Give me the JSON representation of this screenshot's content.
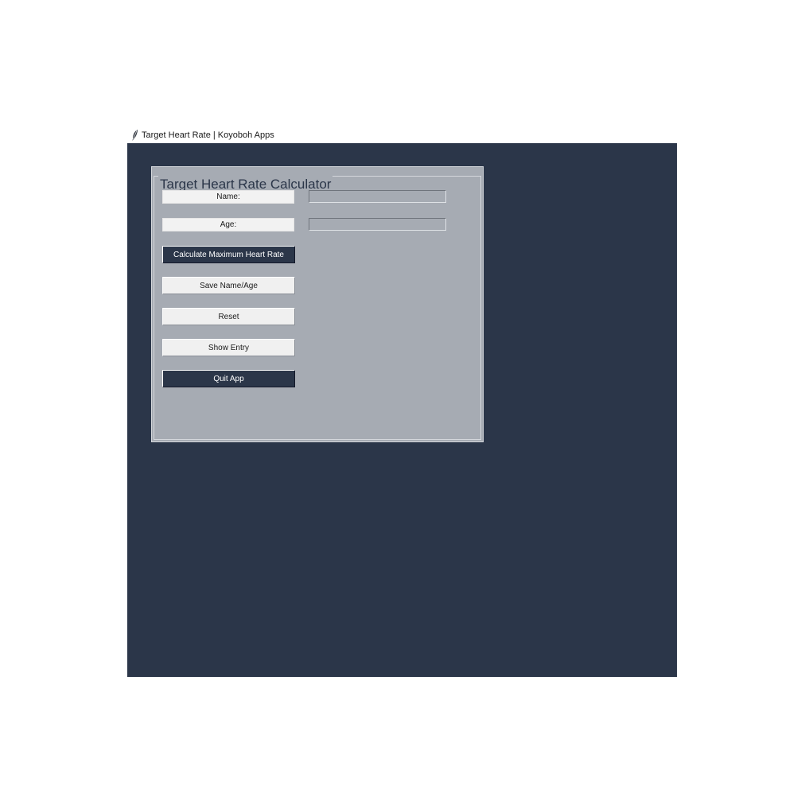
{
  "window": {
    "title": "Target Heart Rate | Koyoboh Apps",
    "icon": "feather-icon"
  },
  "colors": {
    "background": "#2b3649",
    "panel": "#a6abb3",
    "button_light": "#f0f0f0",
    "button_dark": "#2b3649"
  },
  "group": {
    "title": "Target Heart Rate Calculator"
  },
  "form": {
    "name_label": "Name:",
    "name_value": "",
    "age_label": "Age:",
    "age_value": ""
  },
  "buttons": {
    "calculate": "Calculate Maximum Heart Rate",
    "save": "Save Name/Age",
    "reset": "Reset",
    "show": "Show Entry",
    "quit": "Quit App"
  }
}
